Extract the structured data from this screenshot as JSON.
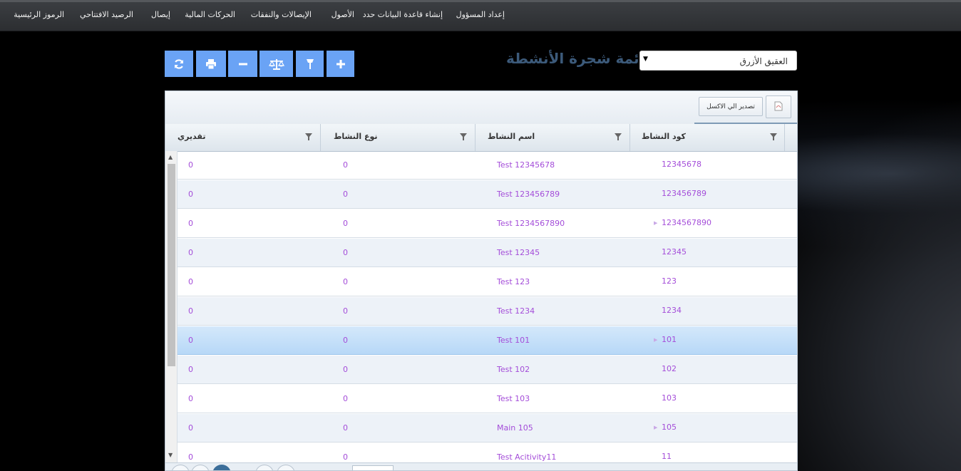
{
  "nav": {
    "items": [
      "إعداد المسؤول",
      "إنشاء قاعدة البيانات حدد",
      "الأصول",
      "الإيصالات والنفقات",
      "الحركات المالية",
      "إيصال",
      "الرصيد الافتتاحي",
      "الرموز الرئيسية"
    ]
  },
  "page": {
    "title": "قائمة شجرة الأنشطة",
    "select_value": "العقيق الأزرق"
  },
  "toolbar": {
    "buttons": [
      "add-icon",
      "tree-icon",
      "balance-icon",
      "minus-icon",
      "print-icon",
      "refresh-icon"
    ]
  },
  "grid": {
    "export_label": "تصدير الي الاكسل",
    "columns": [
      "كود النشاط",
      "اسم النشاط",
      "نوع النشاط",
      "تقديري"
    ],
    "rows": [
      {
        "code": "12345678",
        "name": "Test 12345678",
        "type": "0",
        "estimate": "0",
        "expandable": false,
        "selected": false
      },
      {
        "code": "123456789",
        "name": "Test 123456789",
        "type": "0",
        "estimate": "0",
        "expandable": false,
        "selected": false
      },
      {
        "code": "1234567890",
        "name": "Test 1234567890",
        "type": "0",
        "estimate": "0",
        "expandable": true,
        "selected": false
      },
      {
        "code": "12345",
        "name": "Test 12345",
        "type": "0",
        "estimate": "0",
        "expandable": false,
        "selected": false
      },
      {
        "code": "123",
        "name": "Test 123",
        "type": "0",
        "estimate": "0",
        "expandable": false,
        "selected": false
      },
      {
        "code": "1234",
        "name": "Test 1234",
        "type": "0",
        "estimate": "0",
        "expandable": false,
        "selected": false
      },
      {
        "code": "101",
        "name": "Test 101",
        "type": "0",
        "estimate": "0",
        "expandable": true,
        "selected": true
      },
      {
        "code": "102",
        "name": "Test 102",
        "type": "0",
        "estimate": "0",
        "expandable": false,
        "selected": false
      },
      {
        "code": "103",
        "name": "Test 103",
        "type": "0",
        "estimate": "0",
        "expandable": false,
        "selected": false
      },
      {
        "code": "105",
        "name": "Main 105",
        "type": "0",
        "estimate": "0",
        "expandable": true,
        "selected": false
      },
      {
        "code": "11",
        "name": "Test Acitivity11",
        "type": "0",
        "estimate": "0",
        "expandable": false,
        "selected": false
      }
    ]
  },
  "colors": {
    "accent": "#6aa3f5",
    "title": "#3c5a7a",
    "cell_text": "#a44dd9",
    "selected_row": "#b7d8f7"
  }
}
